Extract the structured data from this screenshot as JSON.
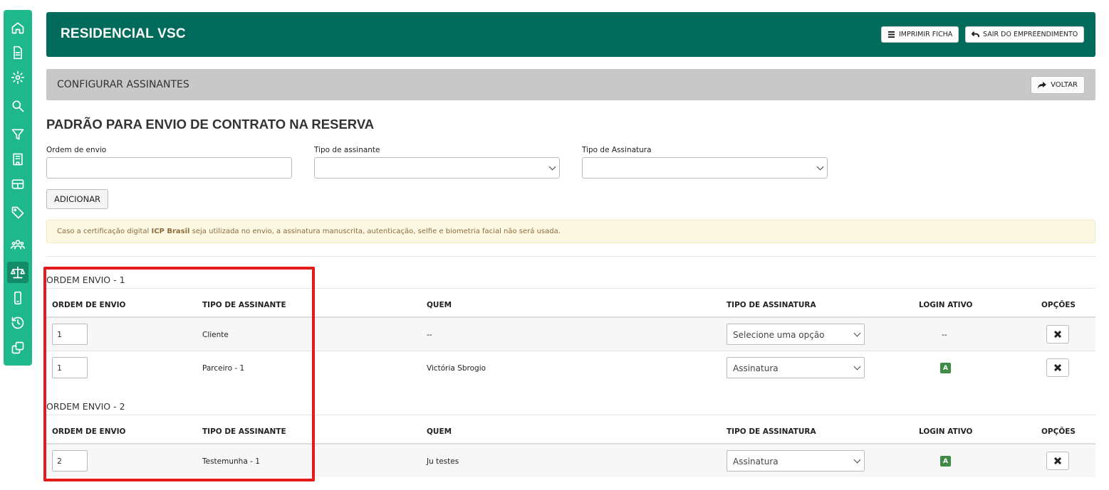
{
  "sidebar": {
    "icons": [
      "home-icon",
      "document-icon",
      "gear-icon",
      "search-icon",
      "filter-icon",
      "building-icon",
      "table-icon",
      "tag-icon",
      "users-icon",
      "scales-icon",
      "mobile-icon",
      "history-icon",
      "copy-icon"
    ],
    "active": "scales-icon",
    "color": "#1fb88c"
  },
  "header": {
    "title": "RESIDENCIAL VSC",
    "print_label": "IMPRIMIR FICHA",
    "exit_label": "SAIR DO EMPREENDIMENTO",
    "color": "#006b5a"
  },
  "subheader": {
    "title": "CONFIGURAR ASSINANTES",
    "back_label": "VOLTAR"
  },
  "section": {
    "title": "PADRÃO PARA ENVIO DE CONTRATO NA RESERVA"
  },
  "form": {
    "order_label": "Ordem de envio",
    "order_value": "",
    "signer_type_label": "Tipo de assinante",
    "signer_type_value": "",
    "signature_type_label": "Tipo de Assinatura",
    "signature_type_value": "",
    "add_label": "ADICIONAR"
  },
  "alert": {
    "text_before": "Caso a certificação digital ",
    "bold": "ICP Brasil",
    "text_after": " seja utilizada no envio, a assinatura manuscrita, autenticação, selfie e biometria facial não será usada."
  },
  "columns": {
    "order": "ORDEM DE ENVIO",
    "signer_type": "TIPO DE ASSINANTE",
    "who": "QUEM",
    "signature_type": "TIPO DE ASSINATURA",
    "login": "LOGIN ATIVO",
    "options": "OPÇÕES"
  },
  "groups": [
    {
      "title": "ORDEM ENVIO - 1",
      "rows": [
        {
          "order": "1",
          "signer_type": "Cliente",
          "who": "--",
          "signature_type": "Selecione uma opção",
          "login": "--",
          "login_badge": false
        },
        {
          "order": "1",
          "signer_type": "Parceiro - 1",
          "who": "Victória Sbrogio",
          "signature_type": "Assinatura",
          "login": "A",
          "login_badge": true
        }
      ]
    },
    {
      "title": "ORDEM ENVIO - 2",
      "rows": [
        {
          "order": "2",
          "signer_type": "Testemunha - 1",
          "who": "Ju testes",
          "signature_type": "Assinatura",
          "login": "A",
          "login_badge": true
        }
      ]
    }
  ],
  "colors": {
    "highlight": "#e31b1b",
    "badge": "#3d8b47",
    "alert_bg": "#fcf8e3"
  }
}
